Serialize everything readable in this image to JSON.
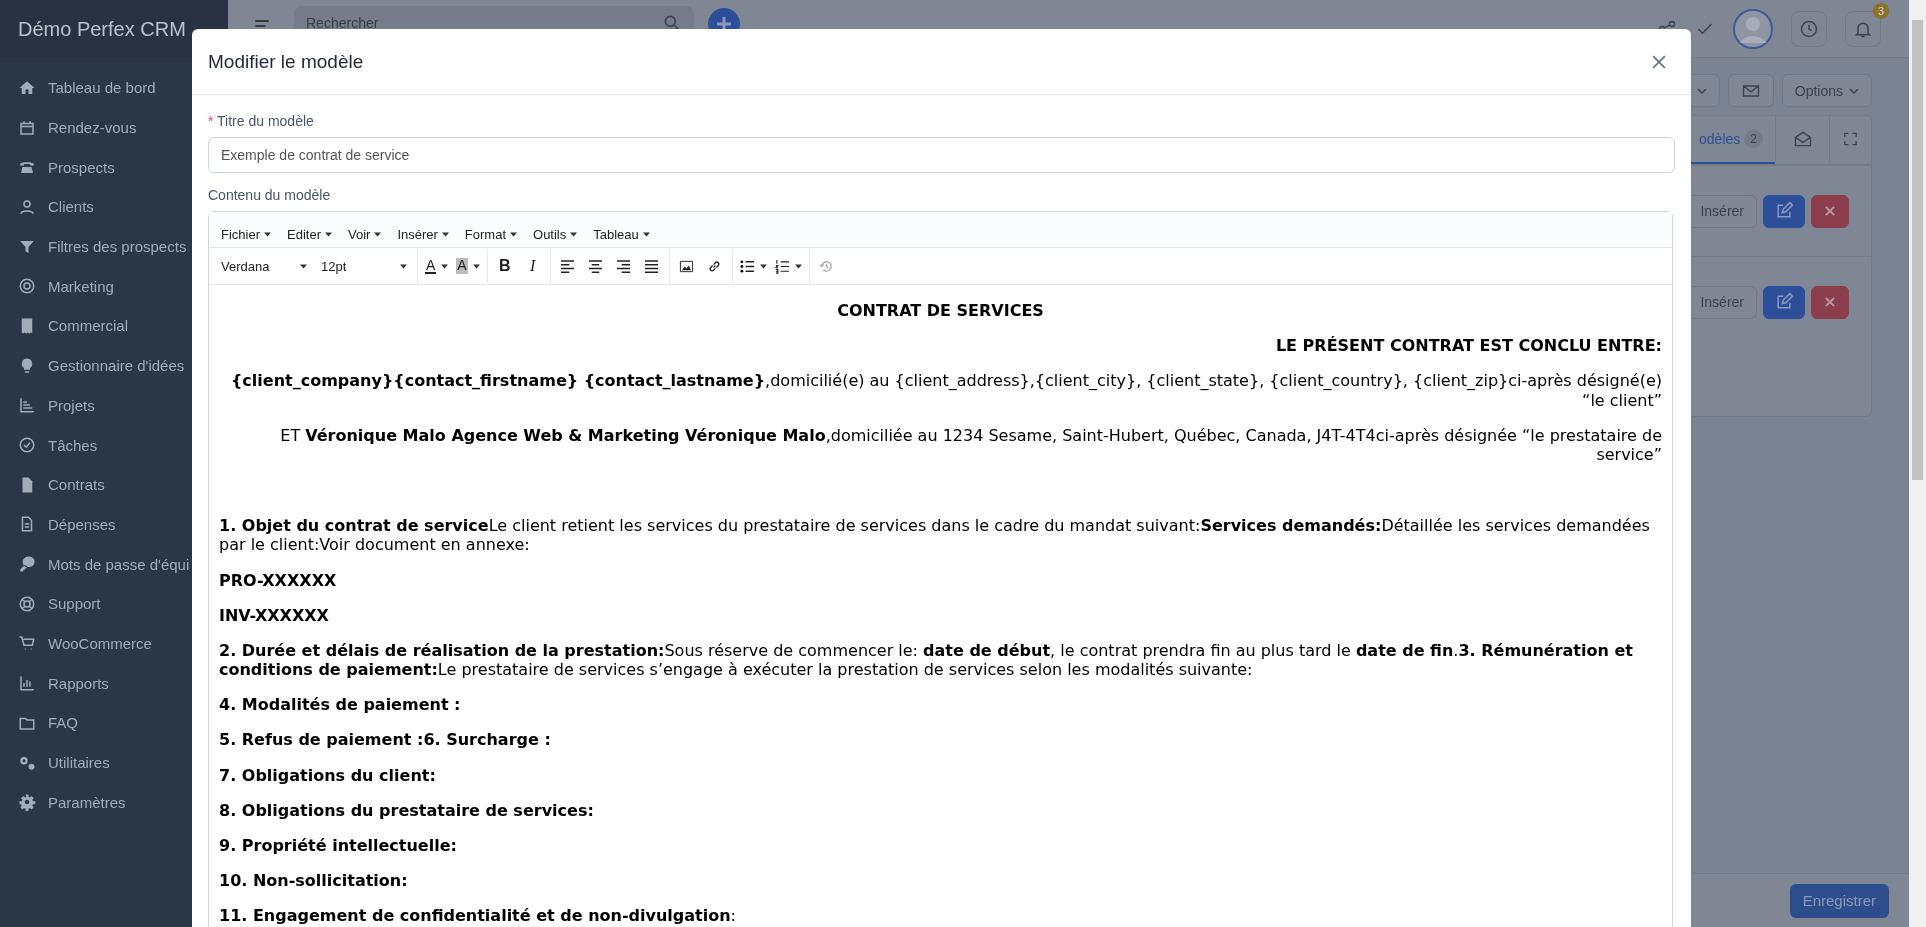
{
  "sidebar": {
    "brand": "Démo Perfex CRM",
    "items": [
      {
        "label": "Tableau de bord"
      },
      {
        "label": "Rendez-vous"
      },
      {
        "label": "Prospects"
      },
      {
        "label": "Clients"
      },
      {
        "label": "Filtres des prospects"
      },
      {
        "label": "Marketing"
      },
      {
        "label": "Commercial"
      },
      {
        "label": "Gestionnaire d'idées"
      },
      {
        "label": "Projets"
      },
      {
        "label": "Tâches"
      },
      {
        "label": "Contrats"
      },
      {
        "label": "Dépenses"
      },
      {
        "label": "Mots de passe d'équi"
      },
      {
        "label": "Support"
      },
      {
        "label": "WooCommerce"
      },
      {
        "label": "Rapports"
      },
      {
        "label": "FAQ"
      },
      {
        "label": "Utilitaires"
      },
      {
        "label": "Paramètres"
      }
    ]
  },
  "topbar": {
    "search": {
      "placeholder": "Rechercher"
    },
    "notification_count": "3"
  },
  "background": {
    "options_button": "Options",
    "tabs": [
      {
        "label": "odèles",
        "count": "2",
        "selected": true
      },
      {
        "selected": false
      },
      {
        "selected": false
      }
    ],
    "rows": [
      {
        "insert_button": "Insérer"
      },
      {
        "insert_button": "Insérer"
      }
    ],
    "save_button": "Enregistrer"
  },
  "modal": {
    "title": "Modifier le modèle",
    "title_field": {
      "required_mark": "*",
      "label": "Titre du modèle",
      "value": "Exemple de contrat de service"
    },
    "content_label": "Contenu du modèle",
    "editor": {
      "menus": [
        "Fichier",
        "Editer",
        "Voir",
        "Insérer",
        "Format",
        "Outils",
        "Tableau"
      ],
      "font": "Verdana",
      "size": "12pt",
      "text_color_glyph": "A",
      "highlight_glyph": "A",
      "bold_glyph": "B",
      "italic_glyph": "I",
      "document": [
        {
          "kind": "title",
          "text": "CONTRAT DE SERVICES"
        },
        {
          "kind": "parties_heading",
          "text": "LE PRÉSENT CONTRAT EST CONCLU ENTRE:"
        },
        {
          "kind": "party",
          "text": "**{client_company}{contact_firstname} {contact_lastname}**,domicilié(e) au {client_address},{client_city}, {client_state}, {client_country}, {client_zip}ci-après désigné(e) “le client”"
        },
        {
          "kind": "party",
          "text": "ET **Véronique Malo Agence Web & Marketing Véronique Malo**,domiciliée au 1234 Sesame, Saint-Hubert, Québec, Canada, J4T-4T4ci-après désignée “le prestataire de service”"
        },
        {
          "kind": "section_start",
          "text": "**1. Objet du contrat de service**Le client retient les services du prestataire de services dans le cadre du mandat suivant:**Services demandés:**Détaillée les services demandées par le client:Voir document en annexe:"
        },
        {
          "kind": "heading",
          "text": "PRO-XXXXXX"
        },
        {
          "kind": "heading",
          "text": "INV-XXXXXX"
        },
        {
          "kind": "body",
          "text": "**2. Durée et délais de réalisation de la prestation:**Sous réserve de commencer le: **date de début**, le contrat prendra fin au plus tard le **date de fin**.**3. Rémunération et conditions de paiement:**Le prestataire de services s’engage à exécuter la prestation de services selon les modalités suivante:"
        },
        {
          "kind": "heading",
          "text": "4. Modalités de paiement :"
        },
        {
          "kind": "heading",
          "text": "5. Refus de paiement :6. Surcharge :"
        },
        {
          "kind": "heading",
          "text": "7. Obligations du client:"
        },
        {
          "kind": "heading",
          "text": "8. Obligations du prestataire de services:"
        },
        {
          "kind": "heading",
          "text": "9. Propriété intellectuelle:"
        },
        {
          "kind": "heading",
          "text": "10. Non-sollicitation:"
        },
        {
          "kind": "body",
          "text": "**11. Engagement de confidentialité et de non-divulgation**:"
        }
      ]
    }
  }
}
